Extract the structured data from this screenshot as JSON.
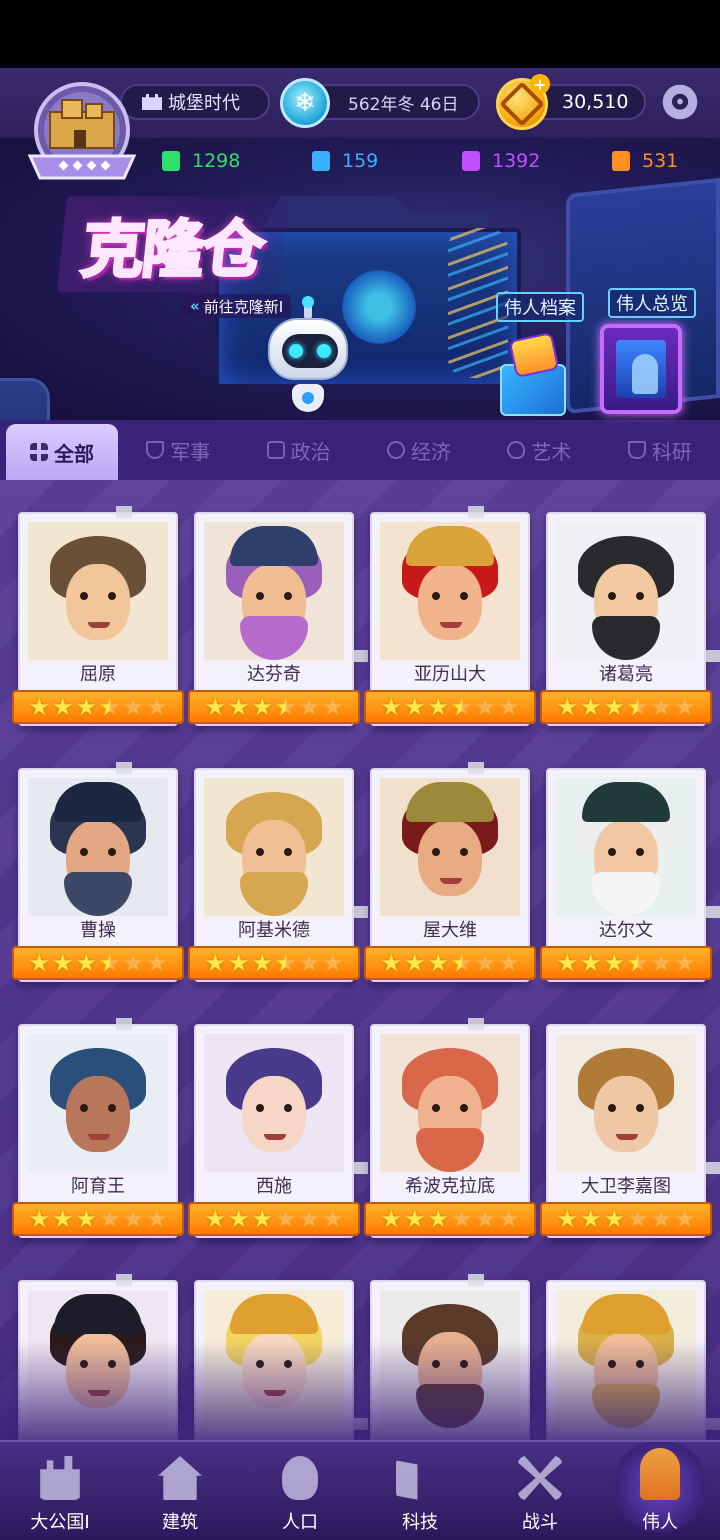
{
  "header": {
    "era": "城堡时代",
    "date": "562年冬 46日",
    "gold": "30,510"
  },
  "resources": [
    {
      "value": "1298",
      "color": "#2ee06a"
    },
    {
      "value": "159",
      "color": "#3bb0ff"
    },
    {
      "value": "1392",
      "color": "#c050ff"
    },
    {
      "value": "531",
      "color": "#ff9020"
    }
  ],
  "banner": {
    "title": "克隆仓",
    "goto_link": "前往克隆新I",
    "archive_label": "伟人档案",
    "overview_label": "伟人总览"
  },
  "tabs": [
    {
      "label": "全部",
      "icon": "grid-icon",
      "active": true
    },
    {
      "label": "军事",
      "icon": "shield-icon",
      "active": false
    },
    {
      "label": "政治",
      "icon": "building-icon",
      "active": false
    },
    {
      "label": "经济",
      "icon": "coins-icon",
      "active": false
    },
    {
      "label": "艺术",
      "icon": "palette-icon",
      "active": false
    },
    {
      "label": "科研",
      "icon": "flask-icon",
      "active": false
    }
  ],
  "heroes": [
    {
      "name": "屈原",
      "stars": 3.5
    },
    {
      "name": "达芬奇",
      "stars": 3.5
    },
    {
      "name": "亚历山大",
      "stars": 3.5
    },
    {
      "name": "诸葛亮",
      "stars": 3.5
    },
    {
      "name": "曹操",
      "stars": 3.5
    },
    {
      "name": "阿基米德",
      "stars": 3.5
    },
    {
      "name": "屋大维",
      "stars": 3.5
    },
    {
      "name": "达尔文",
      "stars": 3.5
    },
    {
      "name": "阿育王",
      "stars": 3
    },
    {
      "name": "西施",
      "stars": 3
    },
    {
      "name": "希波克拉底",
      "stars": 3
    },
    {
      "name": "大卫李嘉图",
      "stars": 3
    },
    {
      "name": "",
      "stars": 0
    },
    {
      "name": "",
      "stars": 0
    },
    {
      "name": "",
      "stars": 0
    },
    {
      "name": "",
      "stars": 0
    }
  ],
  "nav": [
    {
      "label": "大公国I",
      "icon": "castle-icon",
      "active": false
    },
    {
      "label": "建筑",
      "icon": "house-icon",
      "active": false
    },
    {
      "label": "人口",
      "icon": "person-icon",
      "active": false
    },
    {
      "label": "科技",
      "icon": "book-icon",
      "active": false
    },
    {
      "label": "战斗",
      "icon": "swords-icon",
      "active": false
    },
    {
      "label": "伟人",
      "icon": "statue-icon",
      "active": true
    }
  ]
}
